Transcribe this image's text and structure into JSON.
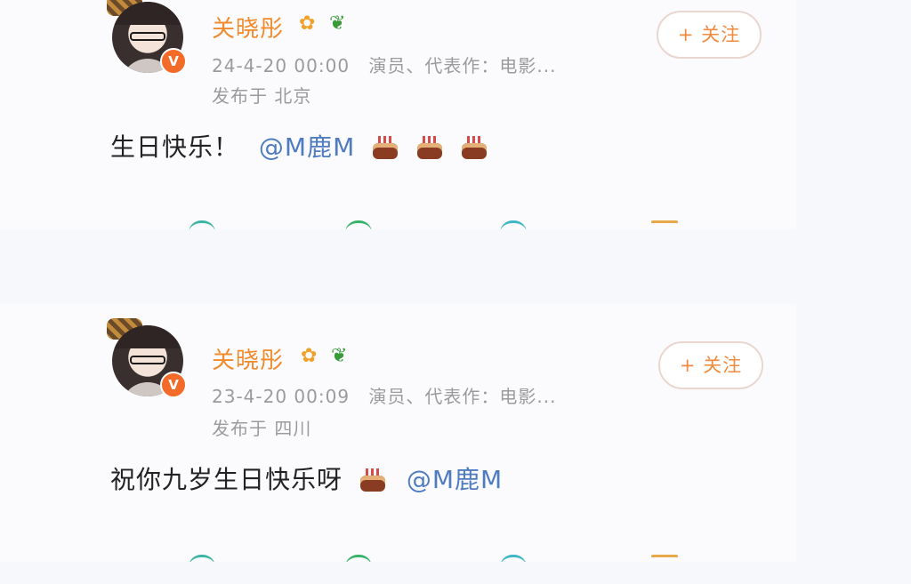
{
  "posts": [
    {
      "username": "关晓彤",
      "timestamp": "24-4-20 00:00",
      "bio": "演员、代表作：电影...",
      "location": "发布于 北京",
      "follow_label": "+ 关注",
      "content_text": "生日快乐！",
      "mention": "@M鹿M",
      "cake_count": 3,
      "icons": [
        "avatar",
        "verified-badge-icon",
        "flower-icon",
        "sprout-icon",
        "cake-icon"
      ]
    },
    {
      "username": "关晓彤",
      "timestamp": "23-4-20 00:09",
      "bio": "演员、代表作：电影...",
      "location": "发布于 四川",
      "follow_label": "+ 关注",
      "content_text": "祝你九岁生日快乐呀",
      "mention": "@M鹿M",
      "cake_count": 1,
      "icons": [
        "avatar",
        "verified-badge-icon",
        "flower-icon",
        "sprout-icon",
        "cake-icon"
      ]
    }
  ],
  "colors": {
    "username": "#f08a2a",
    "mention": "#4f7cc0",
    "meta": "#9b9b9b",
    "follow_text": "#ef8a3e",
    "verified": "#f36b28"
  },
  "glyphs": {
    "verified": "V",
    "flower": "✿",
    "sprout": "❦"
  }
}
